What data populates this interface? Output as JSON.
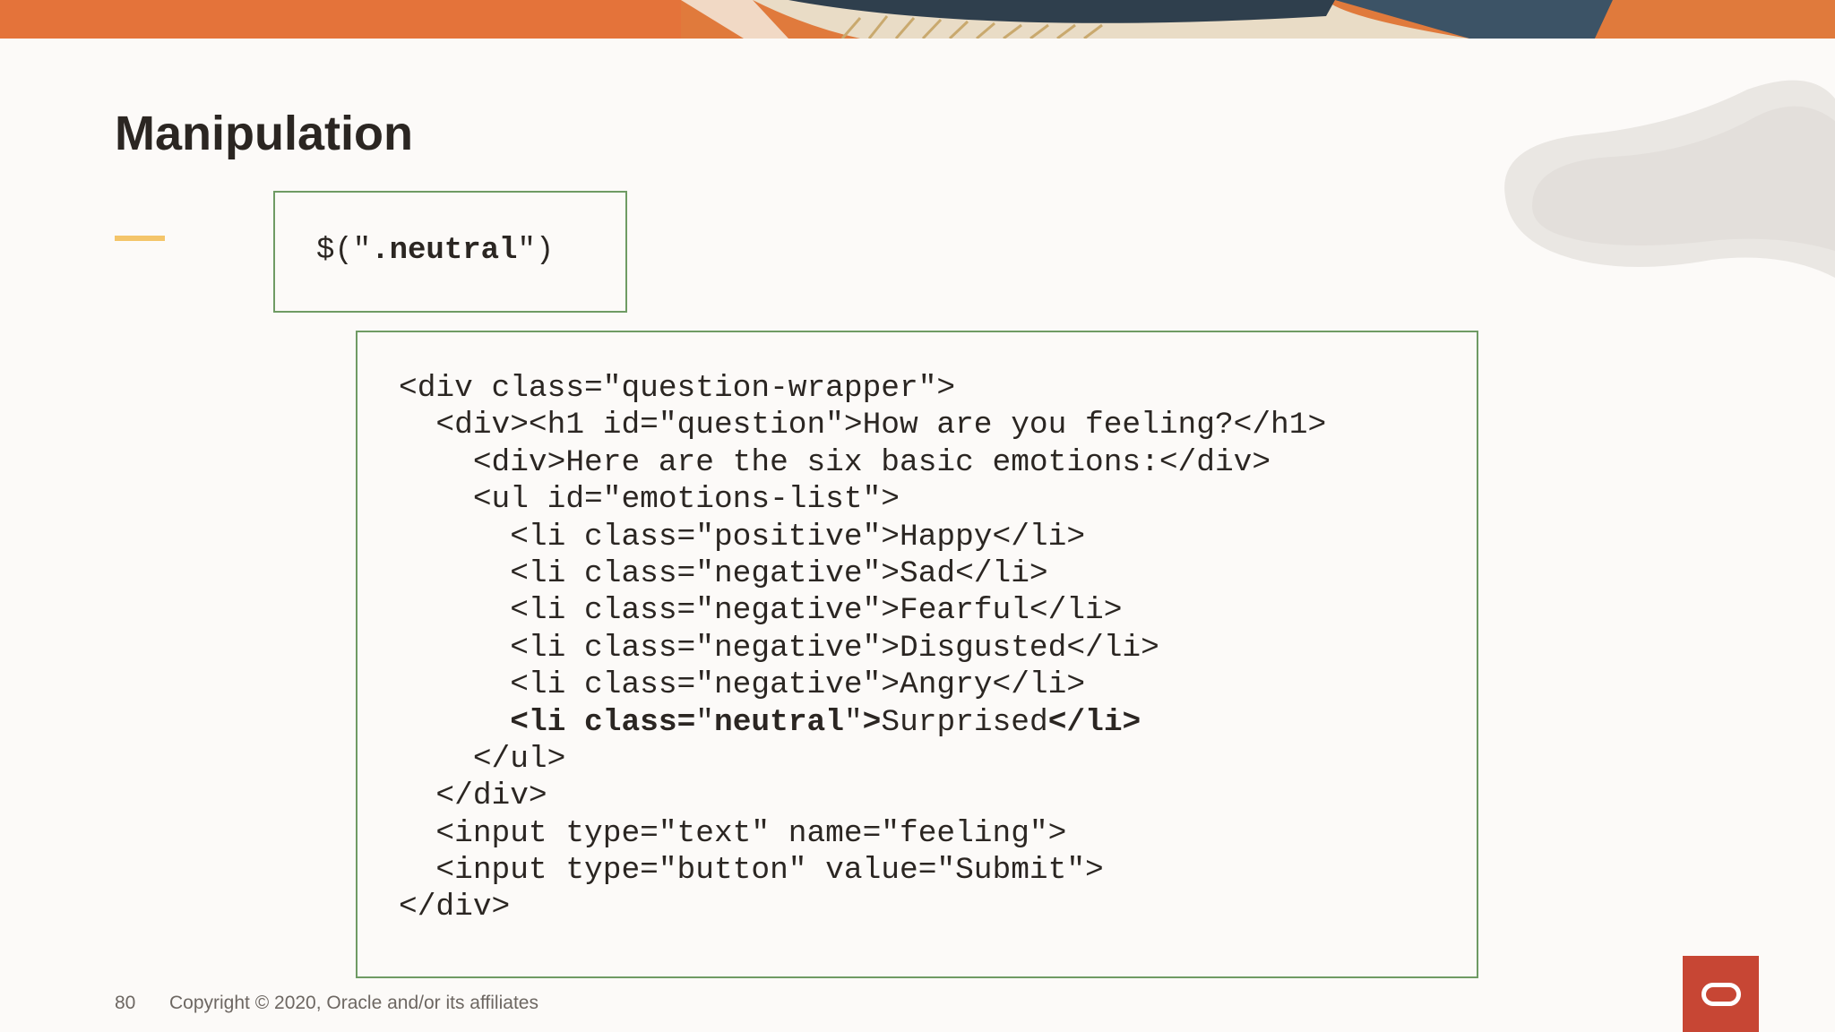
{
  "slide": {
    "title": "Manipulation",
    "page_number": "80",
    "copyright": "Copyright © 2020, Oracle and/or its affiliates"
  },
  "selector": {
    "prefix": "$(\"",
    "bold": ".neutral",
    "suffix": "\")"
  },
  "code_lines": [
    "<div class=\"question-wrapper\">",
    "  <div><h1 id=\"question\">How are you feeling?</h1>",
    "    <div>Here are the six basic emotions:</div>",
    "    <ul id=\"emotions-list\">",
    "      <li class=\"positive\">Happy</li>",
    "      <li class=\"negative\">Sad</li>",
    "      <li class=\"negative\">Fearful</li>",
    "      <li class=\"negative\">Disgusted</li>",
    "      <li class=\"negative\">Angry</li>",
    "      ",
    "    </ul>",
    "  </div>",
    "  <input type=\"text\" name=\"feeling\">",
    "  <input type=\"button\" value=\"Submit\">",
    "</div>"
  ],
  "highlight_line": {
    "indent": "      ",
    "part1": "<li class=",
    "part2": "\"",
    "part3": "neutral",
    "part4": "\"",
    "part5": ">",
    "part6": "Surprised",
    "part7": "</li>"
  },
  "colors": {
    "accent": "#f4c56a",
    "box_border": "#6f9b64",
    "oracle_red": "#c74634",
    "text": "#2b2622"
  },
  "icons": [
    "oracle-logo-icon"
  ]
}
